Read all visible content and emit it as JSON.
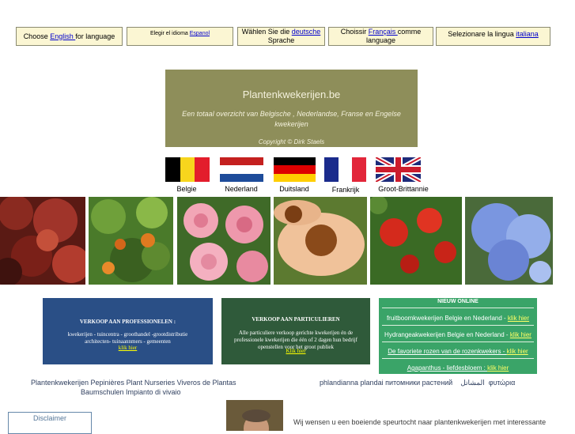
{
  "languages": {
    "en": {
      "before": "Choose ",
      "link": "English ",
      "after": "for language"
    },
    "es": {
      "before": "Elegir el idioma ",
      "link": "Espanol",
      "after": ""
    },
    "de": {
      "before": "Wählen Sie die ",
      "link": "deutsche",
      "after": " Sprache"
    },
    "fr": {
      "before": "Choissir ",
      "link": "Français ",
      "after": "comme language"
    },
    "it": {
      "before": "Selezionare la lingua ",
      "link": "italiana",
      "after": ""
    }
  },
  "banner": {
    "title": "Plantenkwekerijen.be",
    "subtitle": "Een totaal overzicht van Belgische , Nederlandse, Franse en Engelse kwekerijen",
    "copyright": "Copyright © Dirk Staels"
  },
  "flags": [
    {
      "label": "Belgie"
    },
    {
      "label": "Nederland"
    },
    {
      "label": "Duitsland"
    },
    {
      "label": "Frankrijk"
    },
    {
      "label": "Groot-Brittannie"
    }
  ],
  "professional": {
    "heading": "VERKOOP AAN PROFESSIONELEN :",
    "text": "kwekerijen - tuincentra - groothandel -grootdistributie architecten- tuinaannmers - gemeenten",
    "link": "klik hier"
  },
  "private": {
    "heading": "VERKOOP AAN PARTICULIEREN",
    "text": "Alle particuliere verkoop gerichte kwekerijen én de professionele kwekerijen die één of 2 dagen hun bedrijf openstellen voor het groot publiek",
    "link": "Klik hier"
  },
  "online": {
    "heading": "NIEUW ONLINE",
    "items": [
      {
        "text": "fruitboomkwekerijen Belgie en Nederland - ",
        "link": "klik hier"
      },
      {
        "text": "Hydrangeakwekerijen Belgie en Nederland - ",
        "link": "klik hier"
      },
      {
        "text": "De favoriete rozen van de rozenkwekers - ",
        "link": "klik hier"
      },
      {
        "text": "Agapanthus - liefdesbloem : ",
        "link": "klik hier"
      }
    ]
  },
  "footer": {
    "multilang_line1": "Plantenkwekerijen Pepinières Plant Nurseries Viveros de Plantas",
    "multilang_line2": "Baumschulen Impianto di vivaio",
    "multilang_right": "phlandianna plandai питомники растений    المشاتل  φυτώρια",
    "disclaimer": "Disclaimer",
    "welcome": "Wij wensen u een boeiende speurtocht naar plantenkwekerijen met interessante"
  },
  "colors": {
    "banner_bg": "#8e8e5a",
    "professional_bg": "#2a4f86",
    "private_bg": "#2f5a3a",
    "online_bg": "#3aa468",
    "lang_box_bg": "#fbf6d3"
  }
}
